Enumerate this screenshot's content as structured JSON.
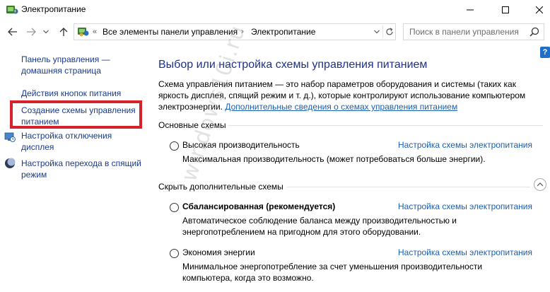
{
  "window": {
    "title": "Электропитание",
    "icon": "power-options-icon"
  },
  "address": {
    "crumbs": [
      "Все элементы панели управления",
      "Электропитание"
    ],
    "search_placeholder": "Поиск в панели управления"
  },
  "sidebar": {
    "items": [
      {
        "label": "Панель управления — домашняя страница"
      },
      {
        "label": "Действия кнопок питания"
      },
      {
        "label": "Создание схемы управления питанием"
      },
      {
        "label": "Настройка отключения дисплея",
        "icon": "monitor-icon"
      },
      {
        "label": "Настройка перехода в спящий режим",
        "icon": "moon-icon"
      }
    ]
  },
  "main": {
    "heading": "Выбор или настройка схемы управления питанием",
    "description": "Схема управления питанием — это набор параметров оборудования и системы (таких как яркость дисплея, спящий режим и т. д.), которые контролируют использование компьютером электроэнергии.",
    "description_link": "Дополнительные сведения о схемах управления питанием",
    "main_plans_label": "Основные схемы",
    "hidden_plans_label": "Скрыть дополнительные схемы",
    "plans": [
      {
        "name": "Высокая производительность",
        "link": "Настройка схемы электропитания",
        "desc": "Максимальная производительность (может потребоваться больше энергии)."
      },
      {
        "name": "Сбалансированная (рекомендуется)",
        "link": "Настройка схемы электропитания",
        "desc": "Автоматическое соблюдение баланса между производительностью и энергопотреблением на пригодном для этого оборудовании."
      },
      {
        "name": "Экономия энергии",
        "link": "Настройка схемы электропитания",
        "desc": "Минимальное энергопотребление за счет уменьшения производительности компьютера, когда это возможно."
      }
    ]
  },
  "help_label": "?",
  "watermark": "windows10i.ru",
  "colors": {
    "link": "#1a5fb4",
    "heading": "#1e3287",
    "highlight": "#d6232b"
  }
}
